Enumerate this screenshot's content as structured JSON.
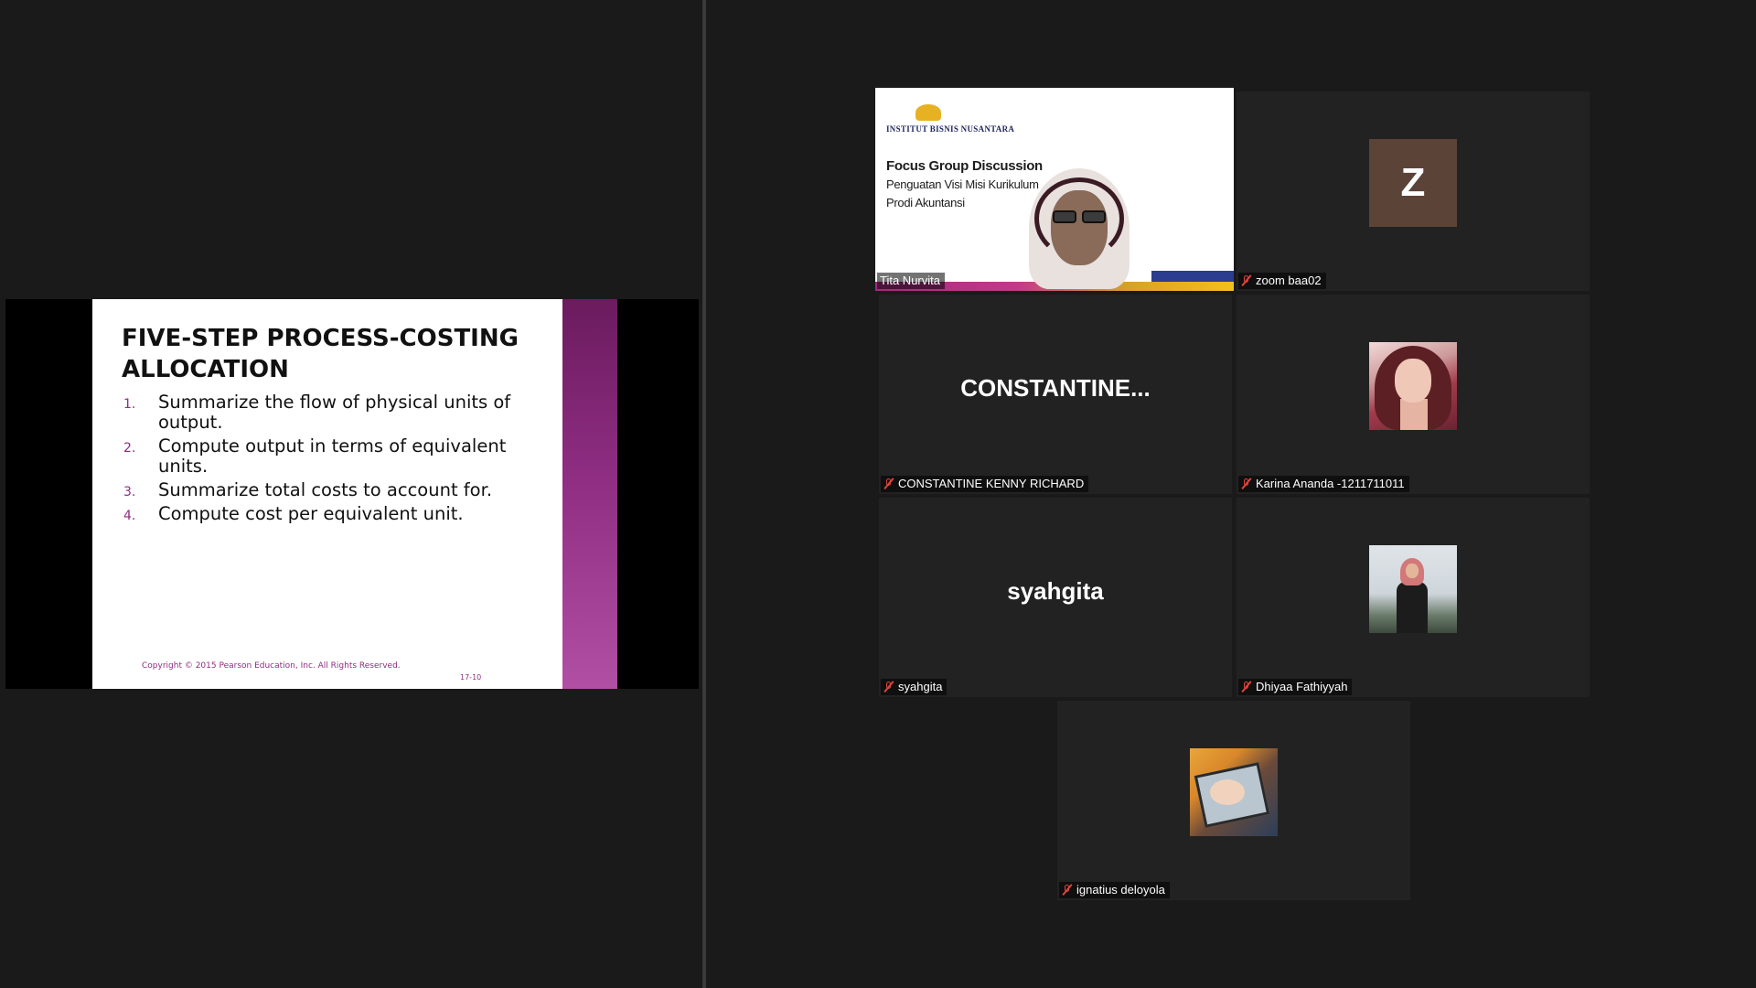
{
  "slide": {
    "title": "FIVE-STEP PROCESS-COSTING ALLOCATION",
    "items": [
      {
        "num": "1.",
        "text": "Summarize the flow of physical units of output."
      },
      {
        "num": "2.",
        "text": "Compute output in terms of equivalent units."
      },
      {
        "num": "3.",
        "text": "Summarize total costs to account for."
      },
      {
        "num": "4.",
        "text": "Compute cost per equivalent unit."
      }
    ],
    "copyright": "Copyright © 2015 Pearson Education, Inc. All Rights Reserved.",
    "page_number": "17-10"
  },
  "participants": {
    "tita": {
      "name": "Tita Nurvita",
      "video": {
        "institution": "INSTITUT BISNIS NUSANTARA",
        "title": "Focus Group Discussion",
        "subtitle": "Penguatan Visi Misi Kurikulum",
        "program": "Prodi Akuntansi"
      }
    },
    "zoom": {
      "name": "zoom baa02",
      "avatar_letter": "Z",
      "muted": true
    },
    "constantine": {
      "name": "CONSTANTINE KENNY RICHARD",
      "display": "CONSTANTINE...",
      "muted": true
    },
    "karina": {
      "name": "Karina Ananda -1211711011",
      "muted": true
    },
    "syahgita": {
      "name": "syahgita",
      "display": "syahgita",
      "muted": true
    },
    "dhiyaa": {
      "name": "Dhiyaa Fathiyyah",
      "muted": true
    },
    "ignatius": {
      "name": "ignatius deloyola",
      "muted": true
    }
  },
  "colors": {
    "background": "#1a1a1a",
    "tile": "#222222",
    "active_speaker": "#b7e33a",
    "muted_icon": "#e0453b",
    "slide_accent": "#8e2d82",
    "avatar_z": "#5c4337"
  }
}
